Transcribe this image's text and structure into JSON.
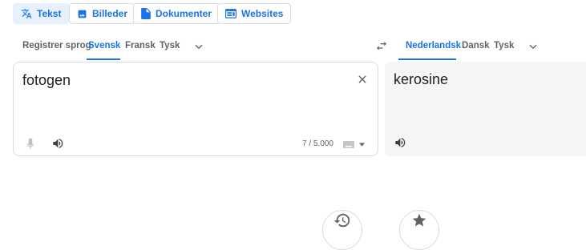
{
  "modes": {
    "text_label": "Tekst",
    "images_label": "Billeder",
    "documents_label": "Dokumenter",
    "websites_label": "Websites"
  },
  "source_langs": {
    "detect": "Registrer sprog",
    "selected": "Svensk",
    "opt2": "Fransk",
    "opt3": "Tysk"
  },
  "target_langs": {
    "selected": "Nederlandsk",
    "opt2": "Dansk",
    "opt3": "Tysk"
  },
  "source": {
    "text": "fotogen",
    "char_count": "7 / 5.000"
  },
  "target": {
    "text": "kerosine"
  },
  "icons": {
    "text_mode": "translate-icon",
    "images_mode": "image-icon",
    "documents_mode": "document-icon",
    "websites_mode": "website-icon",
    "swap": "swap-icon",
    "clear": "close-icon",
    "mic": "mic-icon",
    "speaker": "speaker-icon",
    "keyboard": "keyboard-icon",
    "history": "history-icon",
    "saved": "star-icon"
  },
  "colors": {
    "accent": "#1a73e8",
    "active_bg": "#e8f0fe",
    "target_bg": "#f5f5f5"
  }
}
